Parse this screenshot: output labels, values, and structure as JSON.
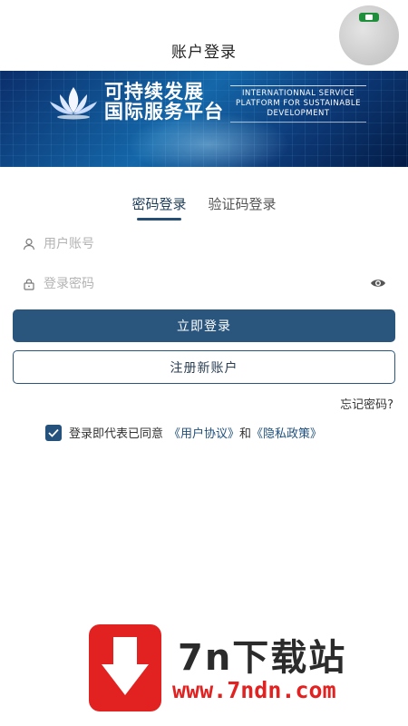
{
  "header": {
    "title": "账户登录"
  },
  "banner": {
    "cn_line1": "可持续发展",
    "cn_line2": "国际服务平台",
    "en_line1": "INTERNATIONNAL SERVICE",
    "en_line2": "PLATFORM FOR SUSTAINABLE",
    "en_line3": "DEVELOPMENT"
  },
  "tabs": [
    {
      "label": "密码登录",
      "active": true
    },
    {
      "label": "验证码登录",
      "active": false
    }
  ],
  "form": {
    "username_placeholder": "用户账号",
    "password_placeholder": "登录密码",
    "login_button": "立即登录",
    "register_button": "注册新账户",
    "forgot": "忘记密码?"
  },
  "agreement": {
    "checked": true,
    "prefix": "登录即代表已同意",
    "user_agreement": "《用户协议》",
    "and": "和",
    "privacy_policy": "《隐私政策》"
  },
  "watermark": {
    "text": "7n下载站",
    "url": "www.7ndn.com"
  },
  "colors": {
    "primary": "#2a557d",
    "watermark_red": "#e22121"
  }
}
